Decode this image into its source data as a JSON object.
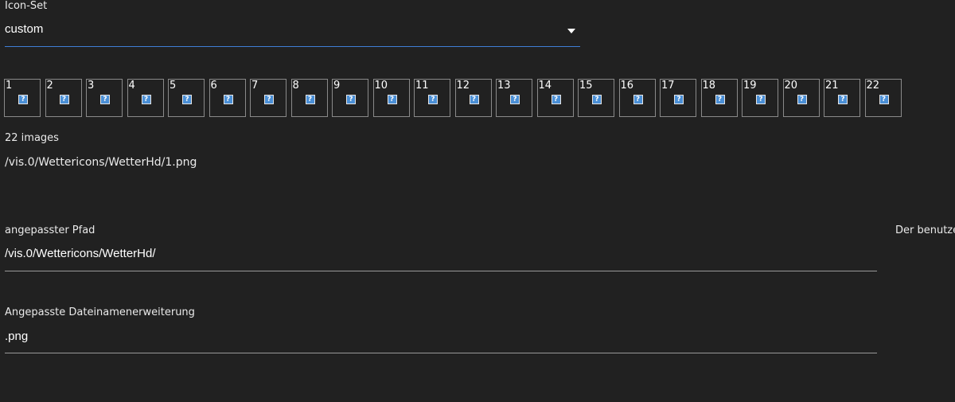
{
  "iconset": {
    "label": "Icon-Set",
    "selected": "custom",
    "arrow_icon": "dropdown-arrow-icon"
  },
  "icons": [
    {
      "num": "1"
    },
    {
      "num": "2"
    },
    {
      "num": "3"
    },
    {
      "num": "4"
    },
    {
      "num": "5"
    },
    {
      "num": "6"
    },
    {
      "num": "7"
    },
    {
      "num": "8"
    },
    {
      "num": "9"
    },
    {
      "num": "10"
    },
    {
      "num": "11"
    },
    {
      "num": "12"
    },
    {
      "num": "13"
    },
    {
      "num": "14"
    },
    {
      "num": "15"
    },
    {
      "num": "16"
    },
    {
      "num": "17"
    },
    {
      "num": "18"
    },
    {
      "num": "19"
    },
    {
      "num": "20"
    },
    {
      "num": "21"
    },
    {
      "num": "22"
    }
  ],
  "broken_image_glyph": "?",
  "image_count": "22 images",
  "sample_path": "/vis.0/Wettericons/WetterHd/1.png",
  "custom_path": {
    "label": "angepasster Pfad",
    "value": "/vis.0/Wettericons/WetterHd/",
    "side_note": "Der benutze"
  },
  "extension": {
    "label": "Angepasste Dateinamenerweiterung",
    "value": ".png"
  },
  "colors": {
    "background": "#212121",
    "accent_underline": "#3f7ed6",
    "broken_icon": "#4a8fd6"
  }
}
